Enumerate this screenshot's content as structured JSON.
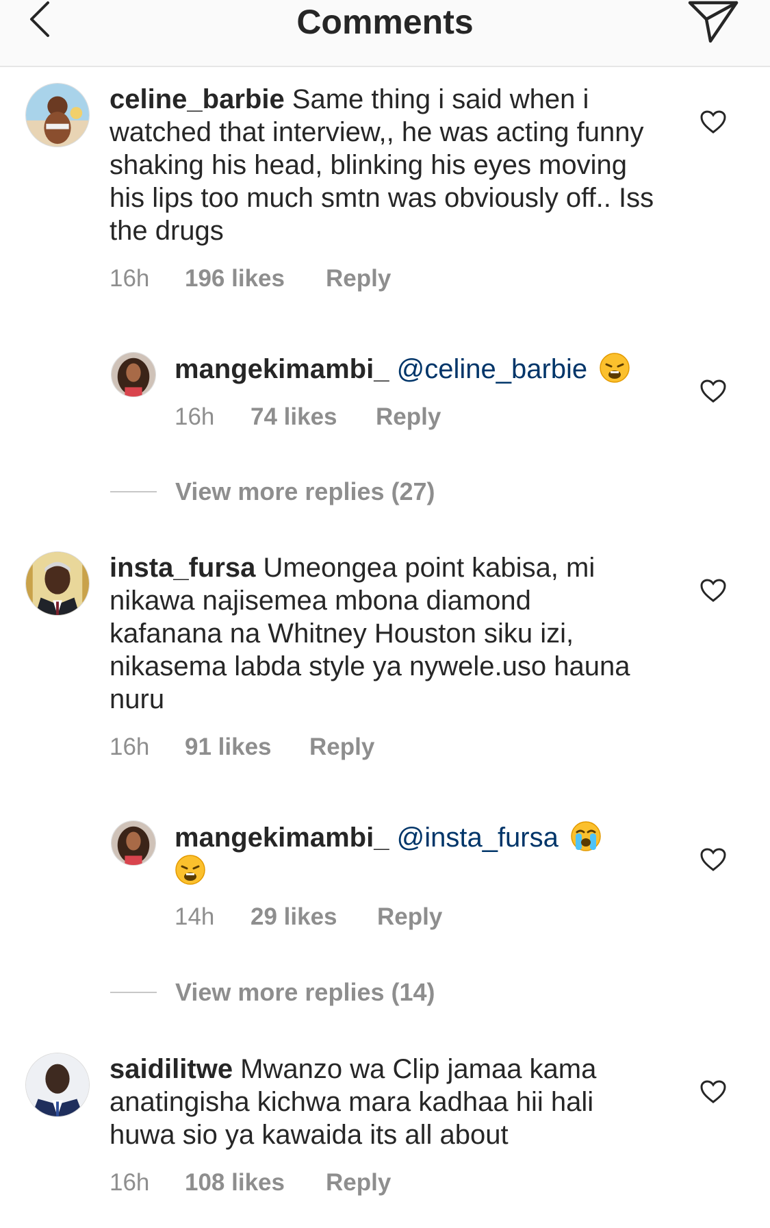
{
  "header": {
    "title": "Comments",
    "back_icon": "chevron-left-icon",
    "send_icon": "paper-plane-icon"
  },
  "comments": [
    {
      "username": "celine_barbie",
      "text": " Same thing i said when i watched that interview,, he was acting funny shaking his head, blinking his eyes moving his lips too much smtn was obviously off.. Iss the drugs",
      "time": "16h",
      "likes": "196 likes",
      "reply": "Reply"
    },
    {
      "username": "mangekimambi_",
      "mention": "@celine_barbie",
      "emoji": "weary-face-emoji",
      "time": "16h",
      "likes": "74 likes",
      "reply": "Reply"
    },
    {
      "view_more": "View more replies (27)"
    },
    {
      "username": "insta_fursa",
      "text": " Umeongea point kabisa, mi nikawa najisemea mbona diamond kafanana na Whitney Houston siku izi, nikasema labda style ya nywele.uso hauna nuru",
      "time": "16h",
      "likes": "91 likes",
      "reply": "Reply"
    },
    {
      "username": "mangekimambi_",
      "mention": "@insta_fursa",
      "emoji": "loudly-crying-face-emoji",
      "emoji2": "weary-face-emoji",
      "time": "14h",
      "likes": "29 likes",
      "reply": "Reply"
    },
    {
      "view_more": "View more replies (14)"
    },
    {
      "username": "saidilitwe",
      "text": " Mwanzo wa Clip jamaa kama anatingisha kichwa mara kadhaa hii hali huwa sio ya kawaida its all about",
      "time": "16h",
      "likes": "108 likes",
      "reply": "Reply"
    }
  ],
  "colors": {
    "text": "#262626",
    "meta": "#8e8e8e",
    "mention": "#003569",
    "header_bg": "#fafafa"
  }
}
